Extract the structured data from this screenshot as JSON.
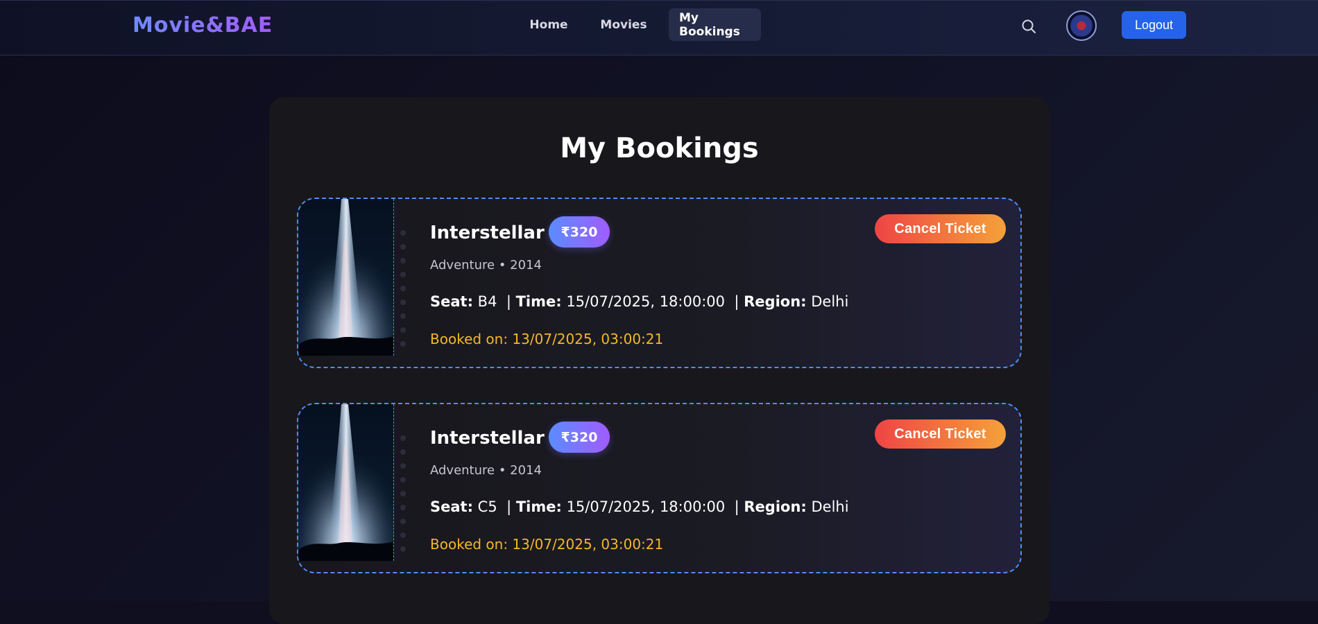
{
  "navbar": {
    "brand": "Movie&BAE",
    "links": [
      {
        "label": "Home"
      },
      {
        "label": "Movies"
      },
      {
        "label": "My Bookings"
      }
    ],
    "active": "My Bookings",
    "search_icon": "search-icon",
    "avatar_icon": "avatar",
    "logout_label": "Logout"
  },
  "page": {
    "title": "My Bookings"
  },
  "labels": {
    "seat": "Seat:",
    "time": "Time:",
    "region": "Region:",
    "booked_on_prefix": "Booked on:",
    "cancel": "Cancel Ticket",
    "separator": "|"
  },
  "bookings": [
    {
      "title": "Interstellar",
      "price": "₹320",
      "genre_year": "Adventure • 2014",
      "seat": "B4",
      "time": "15/07/2025, 18:00:00",
      "region": "Delhi",
      "booked_on": "Booked on: 13/07/2025, 03:00:21"
    },
    {
      "title": "Interstellar",
      "price": "₹320",
      "genre_year": "Adventure • 2014",
      "seat": "C5",
      "time": "15/07/2025, 18:00:00",
      "region": "Delhi",
      "booked_on": "Booked on: 13/07/2025, 03:00:21"
    }
  ],
  "colors": {
    "accent_blue": "#2563eb",
    "dashed_border": "#4f8ef5",
    "booked_text": "#f5b82a",
    "cancel_gradient_start": "#ef4444",
    "cancel_gradient_end": "#f5a13a"
  }
}
